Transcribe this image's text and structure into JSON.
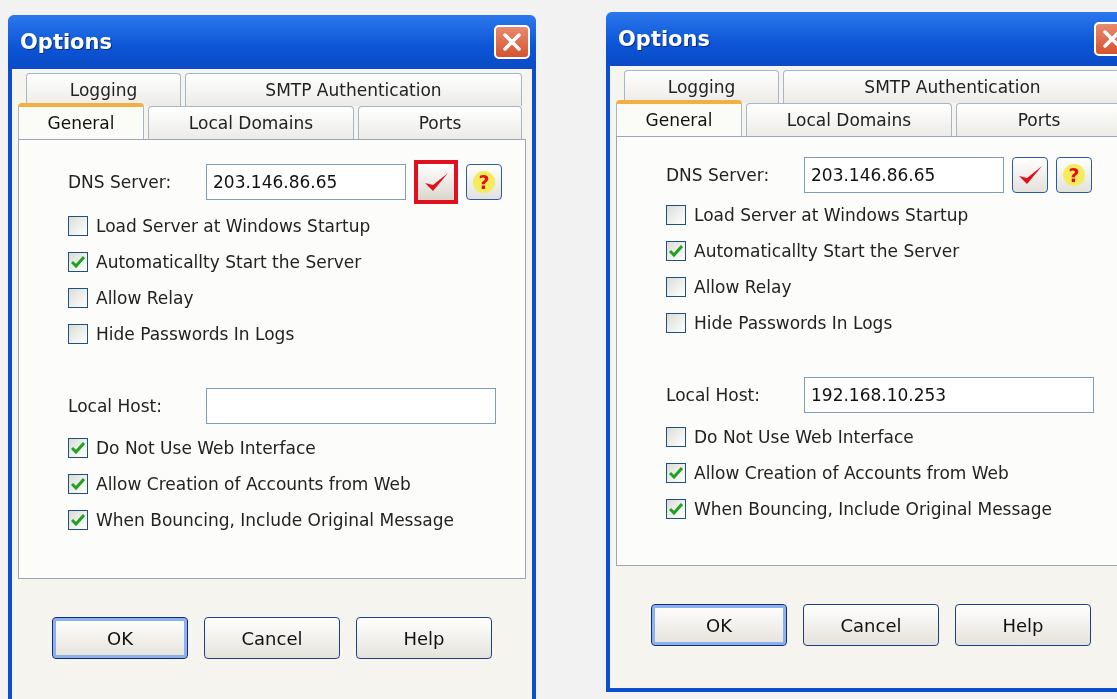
{
  "dialogs": [
    {
      "title": "Options",
      "tab_rows": [
        [
          {
            "label": "Logging",
            "selected": false
          },
          {
            "label": "SMTP Authentication",
            "selected": false
          }
        ],
        [
          {
            "label": "General",
            "selected": true
          },
          {
            "label": "Local Domains",
            "selected": false
          },
          {
            "label": "Ports",
            "selected": false
          }
        ]
      ],
      "dns": {
        "label": "DNS Server:",
        "value": "203.146.86.65",
        "verify_highlighted": true,
        "help_glyph": "?"
      },
      "options": [
        {
          "kind": "checkbox",
          "label": "Load Server at Windows Startup",
          "checked": false
        },
        {
          "kind": "checkbox",
          "label": "Automaticallty Start the Server",
          "checked": true
        },
        {
          "kind": "checkbox",
          "label": "Allow Relay",
          "checked": false
        },
        {
          "kind": "checkbox",
          "label": "Hide Passwords In Logs",
          "checked": false
        },
        {
          "kind": "field",
          "label": "Local Host:"
        },
        {
          "kind": "checkbox",
          "label": "Do Not Use Web Interface",
          "checked": true
        },
        {
          "kind": "checkbox",
          "label": "Allow Creation of Accounts from Web",
          "checked": true
        },
        {
          "kind": "checkbox",
          "label": "When Bouncing, Include Original Message",
          "checked": true
        }
      ],
      "buttons": [
        {
          "label": "OK",
          "default": true
        },
        {
          "label": "Cancel",
          "default": false
        },
        {
          "label": "Help",
          "default": false
        }
      ]
    },
    {
      "title": "Options",
      "tab_rows": [
        [
          {
            "label": "Logging",
            "selected": false
          },
          {
            "label": "SMTP Authentication",
            "selected": false
          }
        ],
        [
          {
            "label": "General",
            "selected": true
          },
          {
            "label": "Local Domains",
            "selected": false
          },
          {
            "label": "Ports",
            "selected": false
          }
        ]
      ],
      "dns": {
        "label": "DNS Server:",
        "value": "203.146.86.65",
        "verify_highlighted": false,
        "help_glyph": "?"
      },
      "options": [
        {
          "kind": "checkbox",
          "label": "Load Server at Windows Startup",
          "checked": false
        },
        {
          "kind": "checkbox",
          "label": "Automaticallty Start the Server",
          "checked": true
        },
        {
          "kind": "checkbox",
          "label": "Allow Relay",
          "checked": false
        },
        {
          "kind": "checkbox",
          "label": "Hide Passwords In Logs",
          "checked": false
        },
        {
          "kind": "field",
          "label": "Local Host:",
          "value": "192.168.10.253"
        },
        {
          "kind": "checkbox",
          "label": "Do Not Use Web Interface",
          "checked": false
        },
        {
          "kind": "checkbox",
          "label": "Allow Creation of Accounts from Web",
          "checked": true
        },
        {
          "kind": "checkbox",
          "label": "When Bouncing, Include Original Message",
          "checked": true
        }
      ],
      "buttons": [
        {
          "label": "OK",
          "default": true
        },
        {
          "label": "Cancel",
          "default": false
        },
        {
          "label": "Help",
          "default": false
        }
      ]
    }
  ]
}
